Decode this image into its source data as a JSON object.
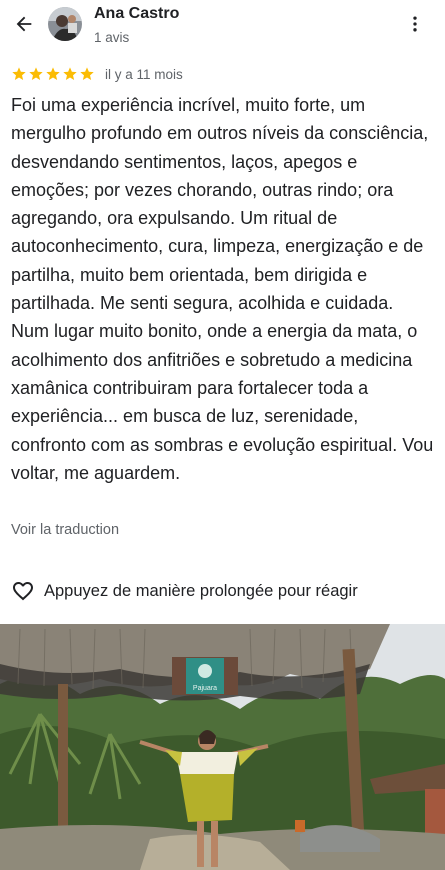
{
  "header": {
    "back_icon": "arrow-left-icon",
    "reviewer_name": "Ana Castro",
    "reviewer_meta": "1 avis",
    "more_icon": "more-vert-icon"
  },
  "review": {
    "stars": 5,
    "star_color": "#fbbc04",
    "time_ago": "il y a 11 mois",
    "text": "Foi  uma experiência incrível, muito forte,  um mergulho profundo em outros níveis da consciência, desvendando sentimentos, laços, apegos e emoções; por vezes chorando, outras rindo; ora agregando, ora expulsando. Um ritual de autoconhecimento, cura, limpeza, energização e de partilha, muito bem orientada, bem dirigida e partilhada. Me senti segura, acolhida e cuidada. Num lugar muito bonito, onde a energia da mata, o acolhimento dos anfitriões e sobretudo a medicina xamânica contribuiram para fortalecer toda a experiência... em busca de luz,  serenidade, confronto com as sombras e evolução espiritual. Vou voltar, me aguardem.",
    "translate_label": "Voir la traduction"
  },
  "reaction": {
    "icon": "heart-outline-icon",
    "label": "Appuyez de manière prolongée pour réagir"
  },
  "photo": {
    "sign_text": "Pajuara"
  }
}
